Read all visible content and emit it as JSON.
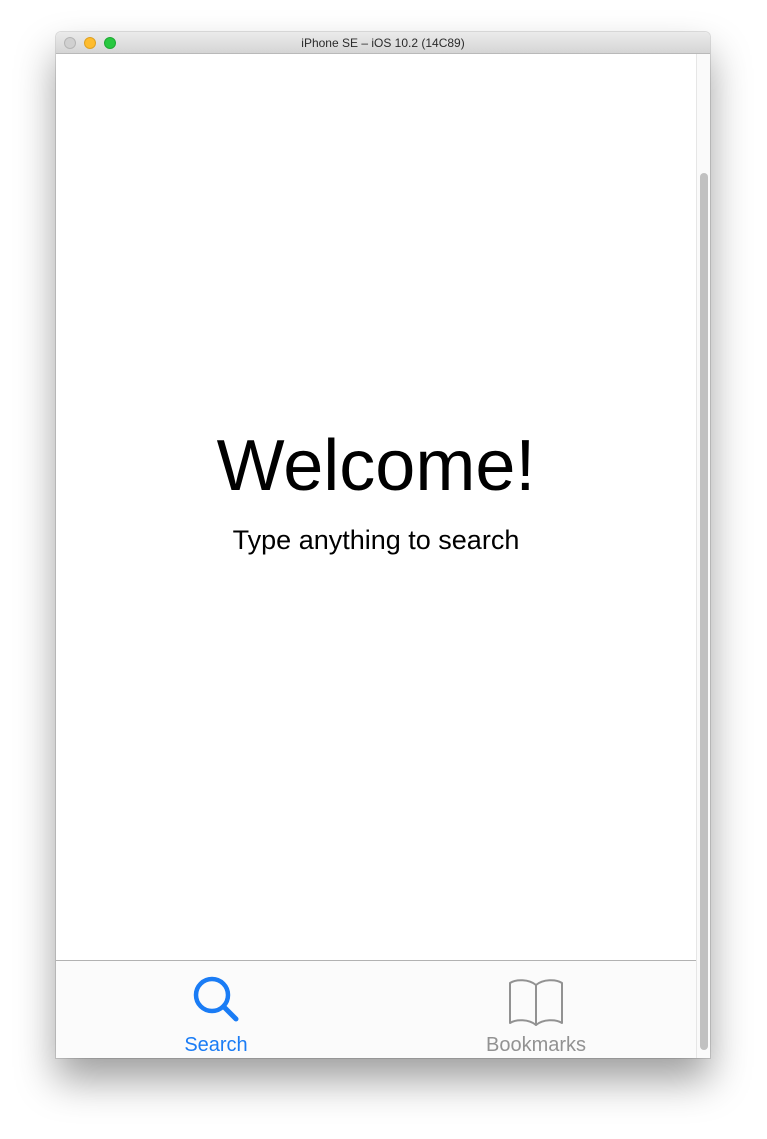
{
  "window": {
    "title": "iPhone SE – iOS 10.2 (14C89)"
  },
  "screen": {
    "welcome_title": "Welcome!",
    "welcome_subtitle": "Type anything to search"
  },
  "tabbar": {
    "tabs": [
      {
        "label": "Search",
        "icon": "search-icon",
        "selected": true,
        "color": "#1a7cf5"
      },
      {
        "label": "Bookmarks",
        "icon": "book-icon",
        "selected": false,
        "color": "#929292"
      }
    ]
  },
  "colors": {
    "accent": "#1a7cf5",
    "inactive_tab": "#929292",
    "traffic_close": "#d0d0d0",
    "traffic_minimize": "#febc2e",
    "traffic_zoom": "#28c840"
  }
}
